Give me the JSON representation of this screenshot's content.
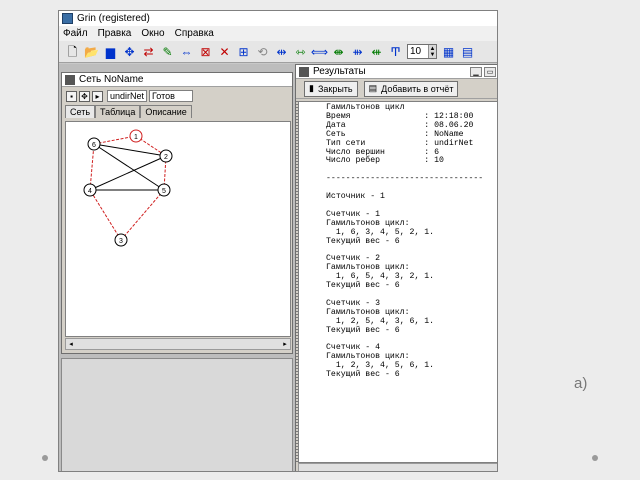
{
  "app": {
    "title": "Grin (registered)",
    "menu": [
      "Файл",
      "Правка",
      "Окно",
      "Справка"
    ],
    "spin_value": "10"
  },
  "net_window": {
    "title": "Сеть NoName",
    "type_field": "undirNet",
    "status_field": "Готов",
    "tabs": [
      "Сеть",
      "Таблица",
      "Описание"
    ],
    "graph": {
      "vertices": [
        "1",
        "2",
        "3",
        "4",
        "5",
        "6"
      ],
      "cycle_color": "#d02020",
      "edge_color": "#000000"
    }
  },
  "results_window": {
    "title": "Результаты",
    "close_button": "Закрыть",
    "add_button": "Добавить в отчёт",
    "report_lines": [
      "Гамильтонов цикл",
      "Время               : 12:18:00",
      "Дата                : 08.06.20",
      "Сеть                : NoName",
      "Тип сети            : undirNet",
      "Число вершин        : 6",
      "Число ребер         : 10",
      "",
      "--------------------------------",
      "",
      "Источник - 1",
      "",
      "Счетчик - 1",
      "Гамильтонов цикл:",
      "  1, 6, 3, 4, 5, 2, 1.",
      "Текущий вес - 6",
      "",
      "Счетчик - 2",
      "Гамильтонов цикл:",
      "  1, 6, 5, 4, 3, 2, 1.",
      "Текущий вес - 6",
      "",
      "Счетчик - 3",
      "Гамильтонов цикл:",
      "  1, 2, 5, 4, 3, 6, 1.",
      "Текущий вес - 6",
      "",
      "Счетчик - 4",
      "Гамильтонов цикл:",
      "  1, 2, 3, 4, 5, 6, 1.",
      "Текущий вес - 6"
    ]
  },
  "slide_label": "a)"
}
